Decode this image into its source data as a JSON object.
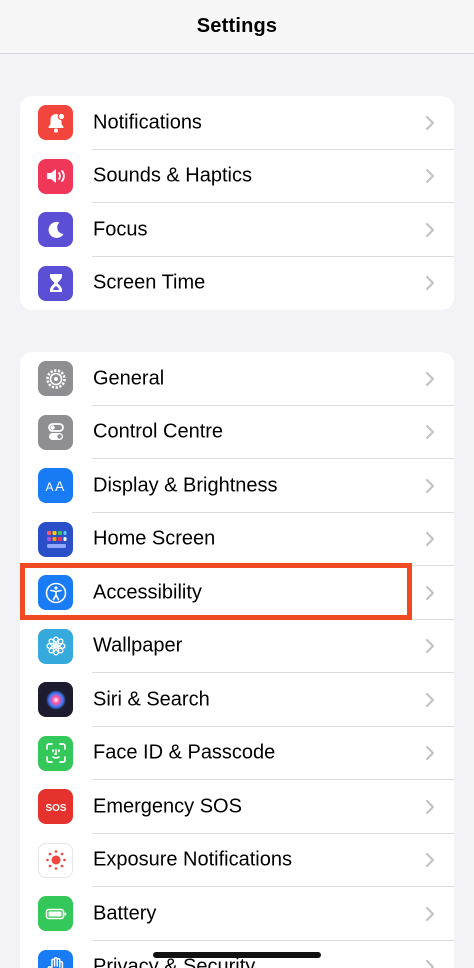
{
  "navbar": {
    "title": "Settings"
  },
  "groups": [
    {
      "items": [
        {
          "label": "Notifications",
          "icon": "bell-icon",
          "color": "#f2453d"
        },
        {
          "label": "Sounds & Haptics",
          "icon": "speaker-icon",
          "color": "#f0375a"
        },
        {
          "label": "Focus",
          "icon": "moon-icon",
          "color": "#5b4fd6"
        },
        {
          "label": "Screen Time",
          "icon": "hourglass-icon",
          "color": "#5b4fd6"
        }
      ]
    },
    {
      "items": [
        {
          "label": "General",
          "icon": "gear-icon",
          "color": "#8e8e93"
        },
        {
          "label": "Control Centre",
          "icon": "toggles-icon",
          "color": "#8e8e93"
        },
        {
          "label": "Display & Brightness",
          "icon": "text-size-icon",
          "color": "#1a7cf5"
        },
        {
          "label": "Home Screen",
          "icon": "app-grid-icon",
          "color": "#2b4fc9"
        },
        {
          "label": "Accessibility",
          "icon": "accessibility-icon",
          "color": "#1a7cf5",
          "highlighted": true
        },
        {
          "label": "Wallpaper",
          "icon": "flower-icon",
          "color": "#36aadd"
        },
        {
          "label": "Siri & Search",
          "icon": "siri-icon",
          "color": "#1c1c2e"
        },
        {
          "label": "Face ID & Passcode",
          "icon": "face-id-icon",
          "color": "#34c759"
        },
        {
          "label": "Emergency SOS",
          "icon": "sos-icon",
          "color": "#e5322c"
        },
        {
          "label": "Exposure Notifications",
          "icon": "exposure-icon",
          "color": "#ffffff"
        },
        {
          "label": "Battery",
          "icon": "battery-icon",
          "color": "#34c759"
        },
        {
          "label": "Privacy & Security",
          "icon": "hand-icon",
          "color": "#1a7cf5"
        }
      ]
    }
  ],
  "highlight_color": "#f04a23"
}
